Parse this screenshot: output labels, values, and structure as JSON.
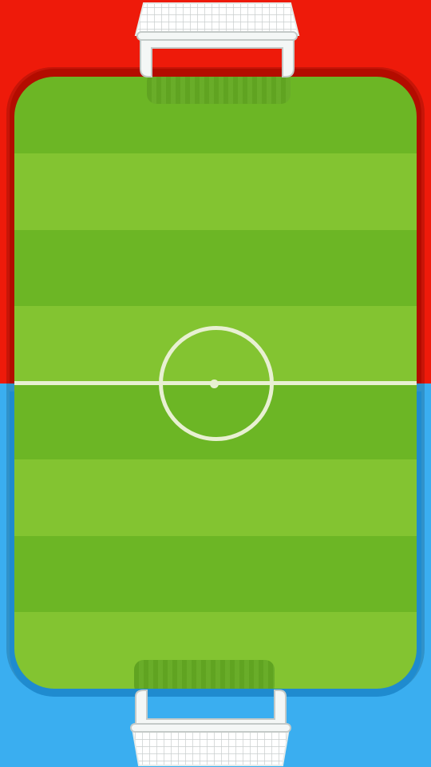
{
  "colors": {
    "top_team": "#ee1a0a",
    "bottom_team": "#3aaef0",
    "grass_dark": "#6cb625",
    "grass_light": "#83c431",
    "field_lines": "#e8f0d2",
    "goal_frame": "#f2f6f3",
    "goal_net": "#d8dcdc"
  },
  "field": {
    "stripes": 8,
    "orientation": "vertical"
  },
  "goals": {
    "top": {
      "icon": "goal-net-icon"
    },
    "bottom": {
      "icon": "goal-net-icon"
    }
  }
}
